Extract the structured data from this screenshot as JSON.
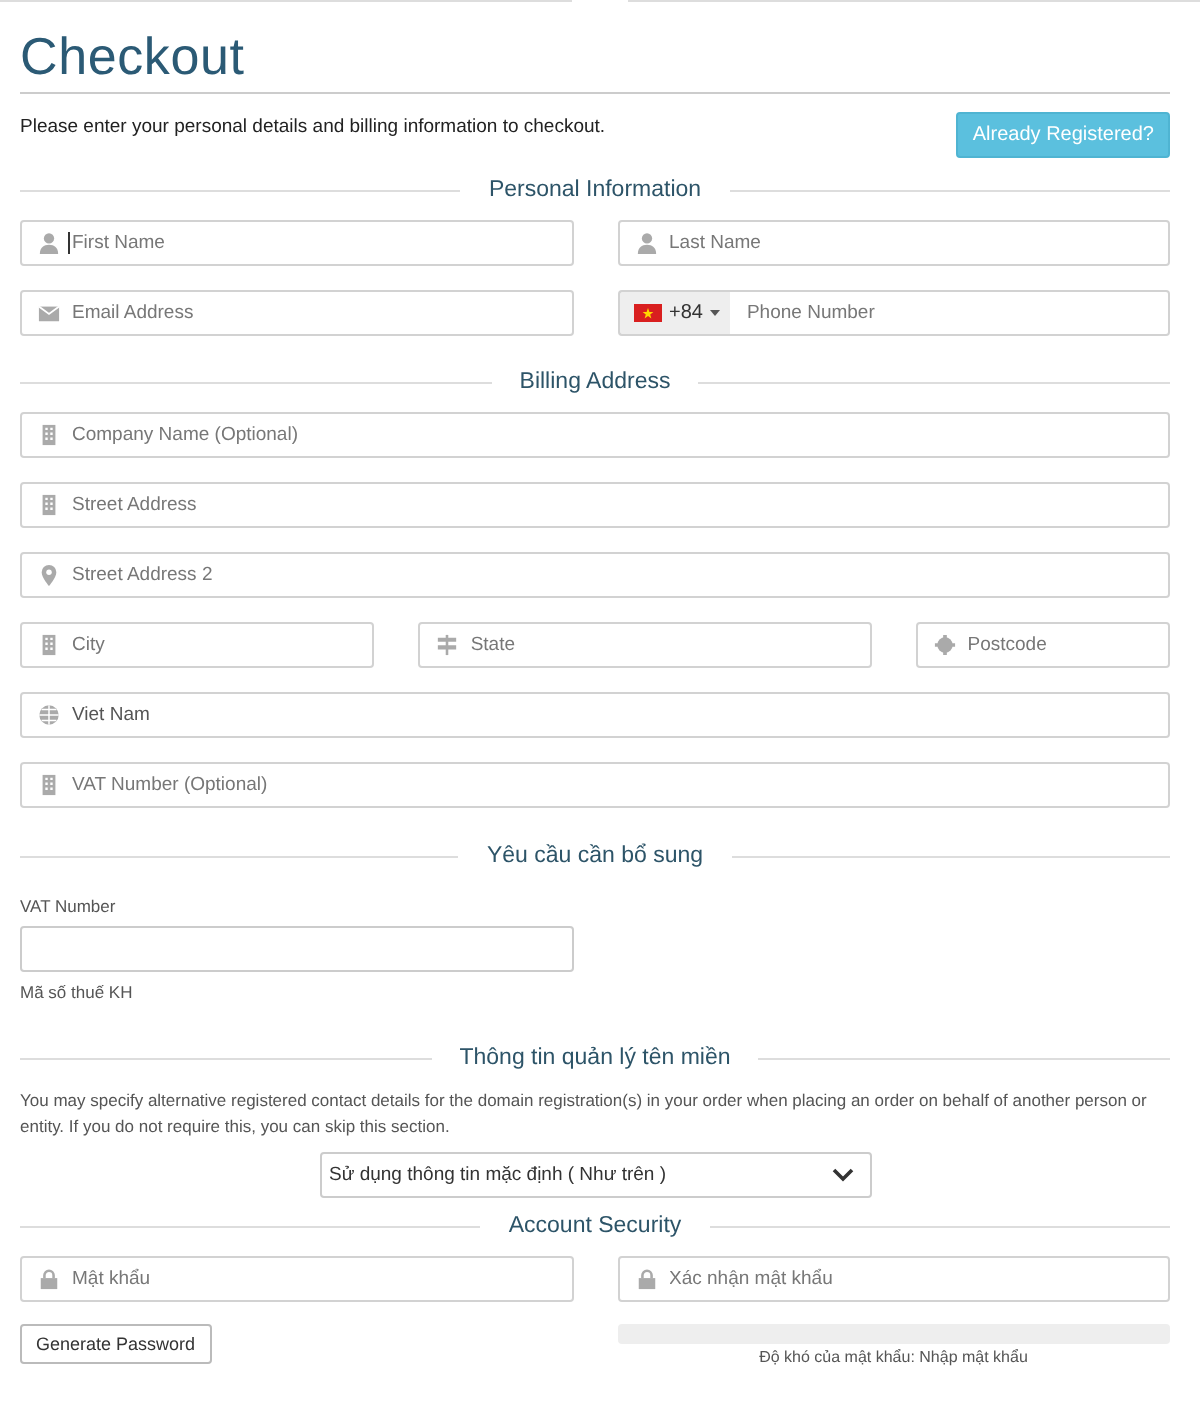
{
  "title": "Checkout",
  "intro": "Please enter your personal details and billing information to checkout.",
  "already_registered_button": "Already Registered?",
  "personal_information": {
    "heading": "Personal Information",
    "rows": [
      [
        {
          "kind": "name",
          "placeholder": "First Name",
          "focused": true
        },
        {
          "kind": "name",
          "placeholder": "Last Name",
          "focused": false
        }
      ],
      [
        {
          "kind": "email",
          "placeholder": "Email Address",
          "focused": false
        },
        {
          "kind": "phone",
          "country_code": "+84",
          "placeholder": "Phone Number",
          "focused": false
        }
      ]
    ]
  },
  "billing_address": {
    "heading": "Billing Address",
    "rows": [
      [
        {
          "kind": "company",
          "placeholder": "Company Name (Optional)",
          "focused": false
        }
      ],
      [
        {
          "kind": "street",
          "placeholder": "Street Address",
          "focused": false
        }
      ],
      [
        {
          "kind": "location",
          "placeholder": "Street Address 2",
          "focused": false
        }
      ],
      [
        {
          "kind": "city",
          "placeholder": "City",
          "focused": false
        },
        {
          "kind": "state",
          "placeholder": "State",
          "focused": false
        },
        {
          "kind": "postcode",
          "placeholder": "Postcode",
          "focused": false
        }
      ],
      [
        {
          "kind": "country",
          "value": "Viet Nam",
          "focused": false
        }
      ],
      [
        {
          "kind": "vat",
          "placeholder": "VAT Number (Optional)",
          "focused": false
        }
      ]
    ]
  },
  "additional_information": {
    "heading": "Yêu cầu cần bổ sung",
    "label": "VAT Number",
    "help": "Mã số thuế KH"
  },
  "domain_contacts": {
    "heading": "Thông tin quản lý tên miền",
    "description": "You may specify alternative registered contact details for the domain registration(s) in your order when placing an order on behalf of another person or entity. If you do not require this, you can skip this section.",
    "selected_option": "Sử dụng thông tin mặc định ( Như trên )"
  },
  "account_security": {
    "heading": "Account Security",
    "rows": [
      [
        {
          "kind": "password",
          "placeholder": "Mật khẩu",
          "focused": false
        },
        {
          "kind": "password",
          "placeholder": "Xác nhận mật khẩu",
          "focused": false
        }
      ]
    ],
    "generate_button": "Generate Password",
    "strength": {
      "level": 0,
      "label": "Độ khó của mật khẩu: Nhập mật khẩu"
    }
  }
}
